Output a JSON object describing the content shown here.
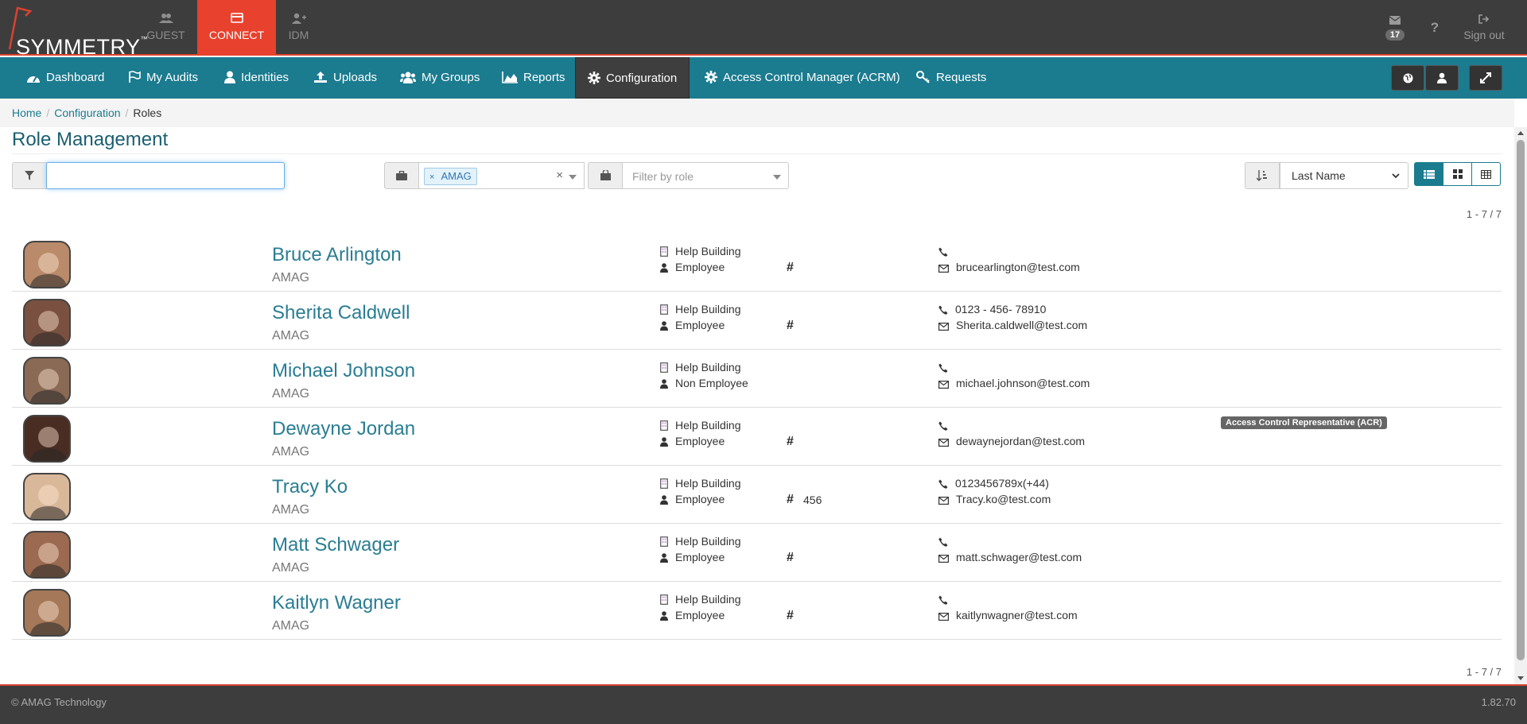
{
  "app": {
    "logo_text": "SYMMETRY",
    "logo_tm": "™"
  },
  "app_tabs": [
    {
      "label": "GUEST",
      "icon": "users-icon"
    },
    {
      "label": "CONNECT",
      "icon": "card-icon"
    },
    {
      "label": "IDM",
      "icon": "user-plus-icon"
    }
  ],
  "top_right": {
    "mail_count": "17",
    "signout_label": "Sign out"
  },
  "nav": {
    "dashboard": "Dashboard",
    "my_audits": "My Audits",
    "identities": "Identities",
    "uploads": "Uploads",
    "my_groups": "My Groups",
    "reports": "Reports",
    "configuration": "Configuration",
    "acrm": "Access Control Manager (ACRM)",
    "requests": "Requests"
  },
  "breadcrumb": {
    "home": "Home",
    "configuration": "Configuration",
    "current": "Roles"
  },
  "page": {
    "title": "Role Management"
  },
  "filters": {
    "search_value": "",
    "org_tag": "AMAG",
    "role_placeholder": "Filter by role",
    "sort_value": "Last Name"
  },
  "pagination": {
    "top": "1 - 7 / 7",
    "bottom": "1 - 7 / 7"
  },
  "people": [
    {
      "name": "Bruce Arlington",
      "org": "AMAG",
      "location": "Help Building",
      "type": "Employee",
      "show_hash": true,
      "number": "",
      "phone": "",
      "email": "brucearlington@test.com",
      "role_badge": "",
      "avatar_bg": "#b98b6a"
    },
    {
      "name": "Sherita Caldwell",
      "org": "AMAG",
      "location": "Help Building",
      "type": "Employee",
      "show_hash": true,
      "number": "",
      "phone": "0123 - 456- 78910",
      "email": "Sherita.caldwell@test.com",
      "role_badge": "",
      "avatar_bg": "#7a5140"
    },
    {
      "name": "Michael Johnson",
      "org": "AMAG",
      "location": "Help Building",
      "type": "Non Employee",
      "show_hash": false,
      "number": "",
      "phone": "",
      "email": "michael.johnson@test.com",
      "role_badge": "",
      "avatar_bg": "#8a6a55"
    },
    {
      "name": "Dewayne Jordan",
      "org": "AMAG",
      "location": "Help Building",
      "type": "Employee",
      "show_hash": true,
      "number": "",
      "phone": "",
      "email": "dewaynejordan@test.com",
      "role_badge": "Access Control Representative (ACR)",
      "avatar_bg": "#4a2d22"
    },
    {
      "name": "Tracy Ko",
      "org": "AMAG",
      "location": "Help Building",
      "type": "Employee",
      "show_hash": true,
      "number": "456",
      "phone": "0123456789x(+44)",
      "email": "Tracy.ko@test.com",
      "role_badge": "",
      "avatar_bg": "#d9b89a"
    },
    {
      "name": "Matt Schwager",
      "org": "AMAG",
      "location": "Help Building",
      "type": "Employee",
      "show_hash": true,
      "number": "",
      "phone": "",
      "email": "matt.schwager@test.com",
      "role_badge": "",
      "avatar_bg": "#9b6a50"
    },
    {
      "name": "Kaitlyn Wagner",
      "org": "AMAG",
      "location": "Help Building",
      "type": "Employee",
      "show_hash": true,
      "number": "",
      "phone": "",
      "email": "kaitlynwagner@test.com",
      "role_badge": "",
      "avatar_bg": "#a47858"
    }
  ],
  "footer": {
    "copyright": "© AMAG Technology",
    "version": "1.82.70"
  },
  "colors": {
    "brand_red": "#e8412e",
    "nav_teal": "#1b7b8f",
    "dark_bar": "#3d3d3d",
    "link": "#2a7d93"
  }
}
